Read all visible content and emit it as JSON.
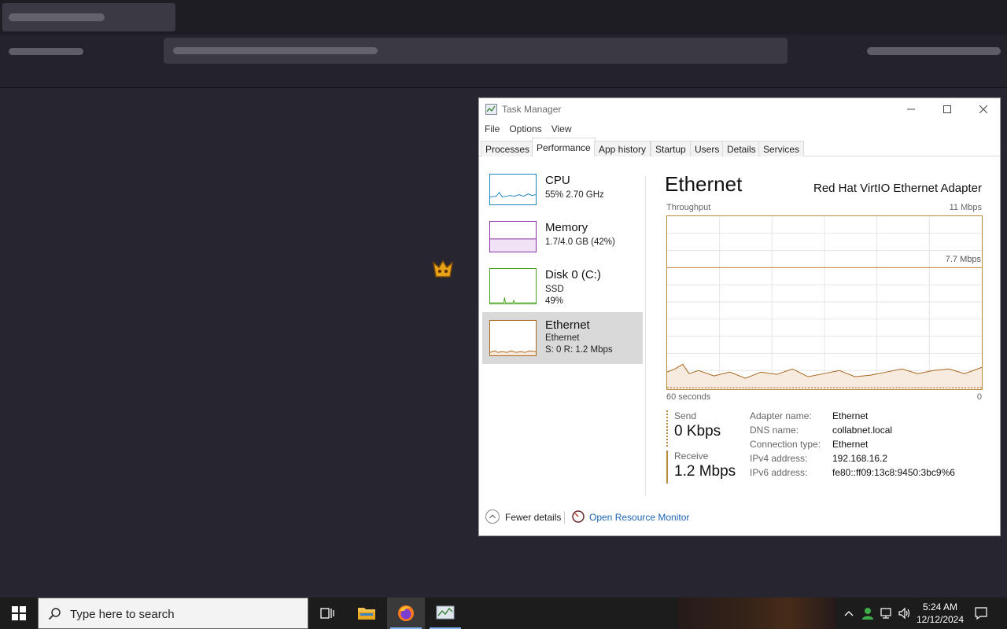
{
  "task_manager": {
    "title": "Task Manager",
    "menu": [
      "File",
      "Options",
      "View"
    ],
    "tabs": [
      "Processes",
      "Performance",
      "App history",
      "Startup",
      "Users",
      "Details",
      "Services"
    ],
    "active_tab": "Performance",
    "sidebar": {
      "cpu": {
        "name": "CPU",
        "sub1": "55%  2.70 GHz",
        "color": "#1b84c2"
      },
      "memory": {
        "name": "Memory",
        "sub1": "1.7/4.0 GB (42%)",
        "color": "#8b2fa8"
      },
      "disk": {
        "name": "Disk 0 (C:)",
        "sub1": "SSD",
        "sub2": "49%",
        "color": "#4aa31c"
      },
      "ethernet": {
        "name": "Ethernet",
        "sub1": "Ethernet",
        "sub2": "S: 0 R: 1.2 Mbps",
        "color": "#a7651d"
      }
    },
    "main": {
      "title": "Ethernet",
      "adapter": "Red Hat VirtIO Ethernet Adapter",
      "throughput_label": "Throughput",
      "max_label": "11 Mbps",
      "mid_label": "7.7 Mbps",
      "axis_left": "60 seconds",
      "axis_right": "0",
      "send_label": "Send",
      "send_value": "0 Kbps",
      "receive_label": "Receive",
      "receive_value": "1.2 Mbps",
      "properties": [
        {
          "key": "Adapter name:",
          "value": "Ethernet"
        },
        {
          "key": "DNS name:",
          "value": "collabnet.local"
        },
        {
          "key": "Connection type:",
          "value": "Ethernet"
        },
        {
          "key": "IPv4 address:",
          "value": "192.168.16.2"
        },
        {
          "key": "IPv6 address:",
          "value": "fe80::ff09:13c8:9450:3bc9%6"
        }
      ]
    },
    "footer": {
      "fewer_details": "Fewer details",
      "resource_monitor": "Open Resource Monitor"
    }
  },
  "taskbar": {
    "search_placeholder": "Type here to search",
    "time": "5:24 AM",
    "date": "12/12/2024"
  }
}
